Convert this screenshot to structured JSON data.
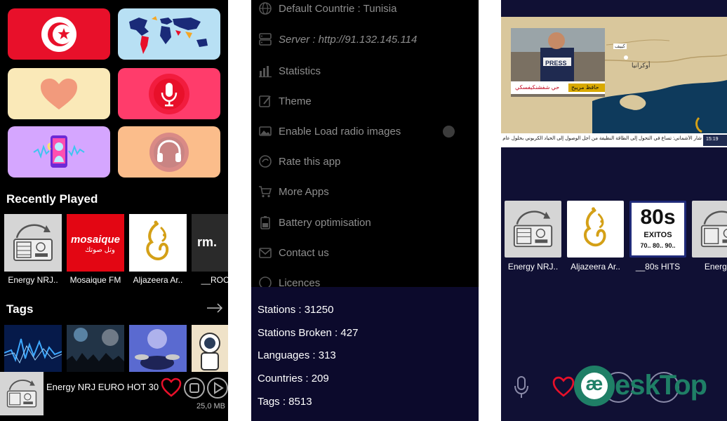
{
  "home": {
    "recently_played_title": "Recently Played",
    "tags_title": "Tags",
    "recently_played": [
      {
        "label": "Energy NRJ..",
        "logo": "radio-icon"
      },
      {
        "label": "Mosaique FM",
        "logo": "mosaique-logo",
        "logo_text": "mosaique",
        "logo_sub": "وتل صوتك"
      },
      {
        "label": "Aljazeera Ar..",
        "logo": "aljazeera-logo"
      },
      {
        "label": "__ROCK_",
        "logo": "rm-logo",
        "logo_text": "rm."
      }
    ],
    "player": {
      "title": "Energy NRJ EURO HOT 30",
      "size": "25,0 MB"
    }
  },
  "settings": {
    "menu": [
      {
        "label": "Default Countrie : Tunisia",
        "icon": "globe-icon"
      },
      {
        "label": "Server : http://91.132.145.114",
        "icon": "server-icon"
      },
      {
        "label": "Statistics",
        "icon": "chart-icon"
      },
      {
        "label": "Theme",
        "icon": "palette-icon"
      },
      {
        "label": "Enable Load radio images",
        "icon": "image-icon"
      },
      {
        "label": "Rate this app",
        "icon": "star-icon"
      },
      {
        "label": "More Apps",
        "icon": "cart-icon"
      },
      {
        "label": "Battery optimisation",
        "icon": "battery-icon"
      },
      {
        "label": "Contact us",
        "icon": "mail-icon"
      },
      {
        "label": "Licences",
        "icon": "license-icon"
      }
    ],
    "stats": [
      "Stations : 31250",
      "Stations Broken : 427",
      "Languages : 313",
      "Countries : 209",
      "Tags : 8513"
    ]
  },
  "player_screen": {
    "video": {
      "badge": "PRESS",
      "caption_name": "حافظ مرييح",
      "caption_place": "حي شفشنكيفسكي",
      "ticker": "شار الأشماني: تساع في التحول إلى الطاقة النظيفة من أجل الوصول إلى الحياد الكربوني بحلول عام",
      "clock": "15:19",
      "map_label_1": "أوكرانيا",
      "map_label_2": "كييف"
    },
    "stations": [
      {
        "label": "Energy NRJ..",
        "logo": "radio-icon"
      },
      {
        "label": "Aljazeera Ar..",
        "logo": "aljazeera-logo"
      },
      {
        "label": "__80s HITS",
        "logo": "80s-logo",
        "logo_big": "80s",
        "logo_mid": "EXITOS",
        "logo_small": "70.. 80.. 90.."
      },
      {
        "label": "Energy (",
        "logo": "radio-icon"
      }
    ]
  },
  "watermark": {
    "text": "eskTop",
    "mark": "æ"
  },
  "colors": {
    "tile_red": "#e8102a",
    "tile_blue": "#b8e0f4",
    "tile_cream": "#fae9b8",
    "tile_pink": "#ff3c6b",
    "tile_lavender": "#d5a6ff",
    "tile_peach": "#fbbd8b",
    "stats_bg": "#0c0a2c",
    "panel3_bg": "#101034"
  }
}
